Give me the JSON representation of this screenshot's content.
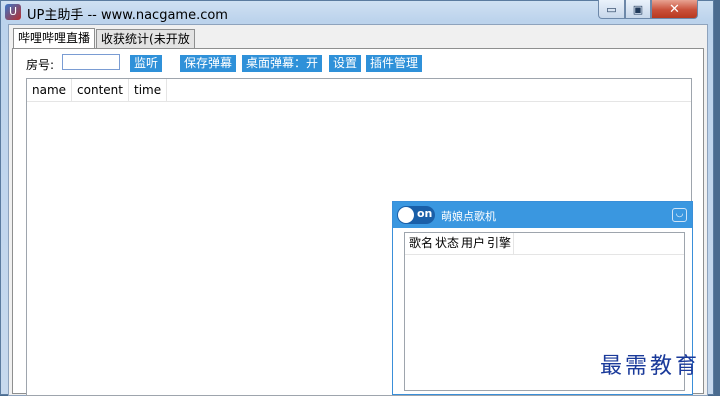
{
  "window": {
    "title": "UP主助手 -- www.nacgame.com",
    "min_symbol": "▭",
    "max_symbol": "▣",
    "close_symbol": "✕"
  },
  "tabs": [
    {
      "label": "哔哩哔哩直播",
      "active": true
    },
    {
      "label": "收获统计(未开放",
      "active": false
    }
  ],
  "toolbar": {
    "room_label": "房号:",
    "room_value": "",
    "listen_button": "监听",
    "save_danmaku_button": "保存弹幕",
    "desktop_danmaku_button": "桌面弹幕：开",
    "settings_button": "设置",
    "plugin_button": "插件管理"
  },
  "danmaku_list": {
    "columns": [
      "name",
      "content",
      "time"
    ],
    "rows": []
  },
  "song_window": {
    "toggle_label": "on",
    "toggle_state": true,
    "title": "萌娘点歌机",
    "columns": [
      "歌名",
      "状态",
      "用户",
      "引擎"
    ],
    "rows": []
  },
  "watermark": "最需教育",
  "colors": {
    "button_bg": "#2f91d9",
    "song_header_bg": "#3a97e0",
    "close_button": "#c9503a"
  }
}
